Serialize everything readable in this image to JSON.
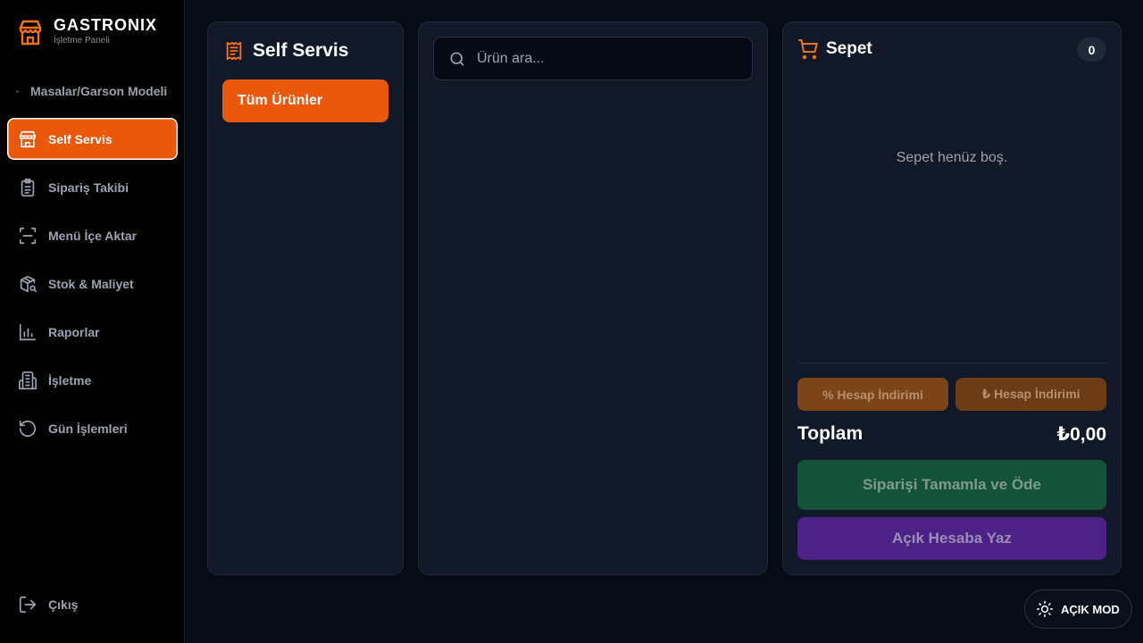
{
  "brand": {
    "title": "GASTRONIX",
    "subtitle": "İşletme Paneli"
  },
  "sidebar": {
    "top_item": "Masalar/Garson Modeli",
    "items": [
      {
        "label": "Self Servis",
        "icon": "store-icon",
        "active": true
      },
      {
        "label": "Sipariş Takibi",
        "icon": "clipboard-icon"
      },
      {
        "label": "Menü İçe Aktar",
        "icon": "scan-icon"
      },
      {
        "label": "Stok & Maliyet",
        "icon": "package-search-icon"
      },
      {
        "label": "Raporlar",
        "icon": "bar-chart-icon"
      },
      {
        "label": "İşletme",
        "icon": "building-icon"
      },
      {
        "label": "Gün İşlemleri",
        "icon": "rotate-ccw-icon"
      }
    ],
    "logout": "Çıkış"
  },
  "categories": {
    "title": "Self Servis",
    "items": [
      {
        "label": "Tüm Ürünler",
        "active": true
      }
    ]
  },
  "products": {
    "search_placeholder": "Ürün ara..."
  },
  "cart": {
    "title": "Sepet",
    "count": "0",
    "empty_text": "Sepet henüz boş.",
    "percent_discount": "% Hesap İndirimi",
    "amount_discount": "₺ Hesap İndirimi",
    "total_label": "Toplam",
    "total_value": "₺0,00",
    "pay_button": "Siparişi Tamamla ve Öde",
    "open_account_button": "Açık Hesaba Yaz"
  },
  "theme_toggle": "AÇIK MOD",
  "colors": {
    "accent": "#ea580c",
    "panel": "#111827",
    "pay": "#14533a",
    "open_account": "#4c2286"
  }
}
